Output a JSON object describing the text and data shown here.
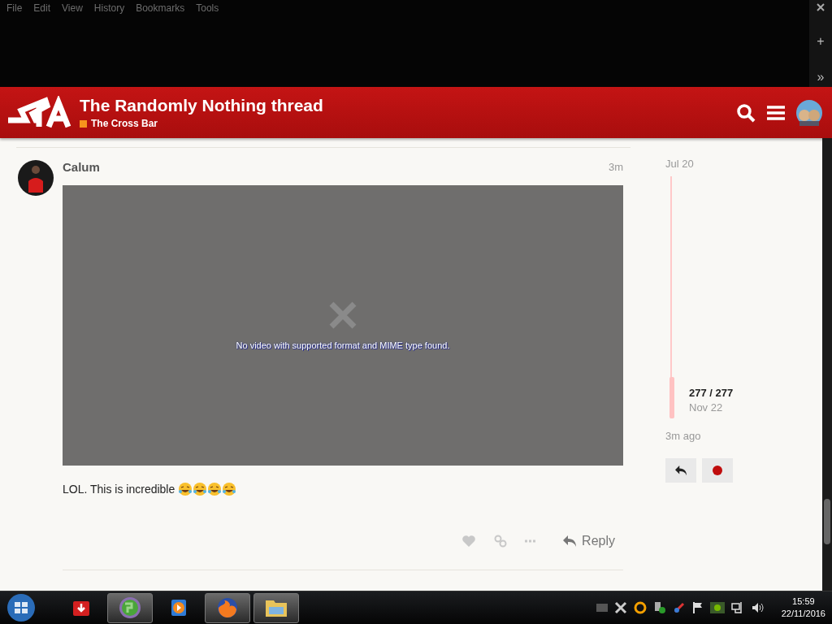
{
  "browser": {
    "menu": [
      "File",
      "Edit",
      "View",
      "History",
      "Bookmarks",
      "Tools"
    ],
    "new_tab": "+",
    "more": "»"
  },
  "header": {
    "title": "The Randomly Nothing thread",
    "category": "The Cross Bar"
  },
  "post": {
    "author": "Calum",
    "time": "3m",
    "video_error": "No video with supported format and MIME type found.",
    "text": "LOL. This is incredible",
    "emojis": [
      {
        "kind": "laughing"
      },
      {
        "kind": "laughing"
      },
      {
        "kind": "laughing"
      },
      {
        "kind": "laughing"
      }
    ],
    "reply": "Reply"
  },
  "timeline": {
    "start": "Jul 20",
    "position": "277 / 277",
    "end_date": "Nov 22",
    "last": "3m ago",
    "level": 0.17
  },
  "taskbar": {
    "items": [
      {
        "kind": "download",
        "running": false
      },
      {
        "kind": "globe",
        "running": true
      },
      {
        "kind": "player",
        "running": false
      },
      {
        "kind": "firefox",
        "running": true
      },
      {
        "kind": "folder",
        "running": true
      }
    ],
    "time": "15:59",
    "date": "22/11/2016"
  }
}
